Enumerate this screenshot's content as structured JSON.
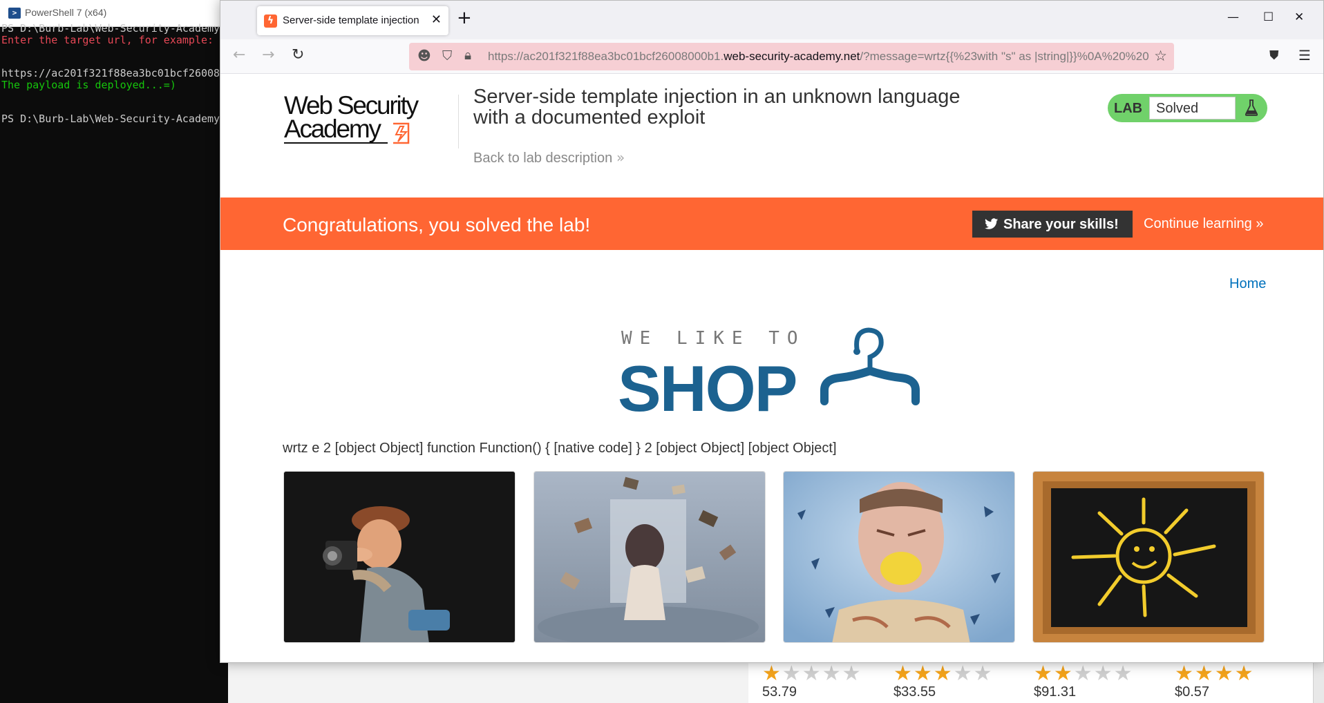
{
  "powershell": {
    "window_title": "PowerShell 7 (x64)",
    "lines": [
      {
        "text": "PS D:\\Burb-Lab\\Web-Security-Academy",
        "color": "#cccccc"
      },
      {
        "text": "Enter the target url, for example:",
        "color": "#e74856"
      },
      {
        "text": "https://ac201f321f88ea3bc01bcf26008",
        "color": "#cccccc"
      },
      {
        "text": "The payload is deployed...=)",
        "color": "#16c60c"
      },
      {
        "text": "PS D:\\Burb-Lab\\Web-Security-Academy",
        "color": "#cccccc"
      }
    ]
  },
  "background_shop": {
    "items": [
      {
        "rating": 1,
        "price": "53.79"
      },
      {
        "rating": 3,
        "price": "$33.55"
      },
      {
        "rating": 2,
        "price": "$91.31"
      },
      {
        "rating": 5,
        "price": "$0.57"
      }
    ]
  },
  "browser": {
    "tab": {
      "title": "Server-side template injection in an unknown language with a documented exploit",
      "close_glyph": "✕"
    },
    "new_tab_glyph": "+",
    "window_controls": {
      "minimize": "—",
      "maximize": "☐",
      "close": "✕"
    },
    "nav": {
      "back": "←",
      "forward": "→",
      "reload": "↻"
    },
    "url": {
      "prefix": "https://ac201f321f88ea3bc01bcf26008000b1.",
      "domain": "web-security-academy.net",
      "path": "/?message=wrtz{{%23with \"s\" as |string|}}%0A%20%20"
    },
    "icons": {
      "url_left_1": "mask-icon",
      "url_left_2": "shield-icon",
      "url_left_3": "lock-icon",
      "bookmark": "star-icon",
      "pocket": "pocket-icon",
      "menu": "hamburger-menu-icon"
    }
  },
  "page": {
    "logo": {
      "line1": "Web Security",
      "line2": "Academy"
    },
    "lab_title": "Server-side template injection in an unknown language with a documented exploit",
    "back_link": "Back to lab description",
    "back_chevron": "»",
    "lab_badge": {
      "label": "LAB",
      "status": "Solved"
    },
    "congrats": {
      "message": "Congratulations, you solved the lab!",
      "share_button": "Share your skills!",
      "continue_link": "Continue learning »"
    },
    "home_link": "Home",
    "banner": {
      "tagline": "WE LIKE TO",
      "word": "SHOP"
    },
    "injected_output": "wrtz e 2 [object Object] function Function() { [native code] } 2 [object Object] [object Object]",
    "products": [
      {
        "image": "photographer-figurine"
      },
      {
        "image": "floating-books-woman"
      },
      {
        "image": "man-with-lemon"
      },
      {
        "image": "chalkboard-sun"
      }
    ]
  },
  "colors": {
    "accent_orange": "#ff6633",
    "lab_green": "#70d16a",
    "link_blue": "#0071bc",
    "shop_blue": "#1c6290",
    "star_gold": "#f3a31b"
  }
}
